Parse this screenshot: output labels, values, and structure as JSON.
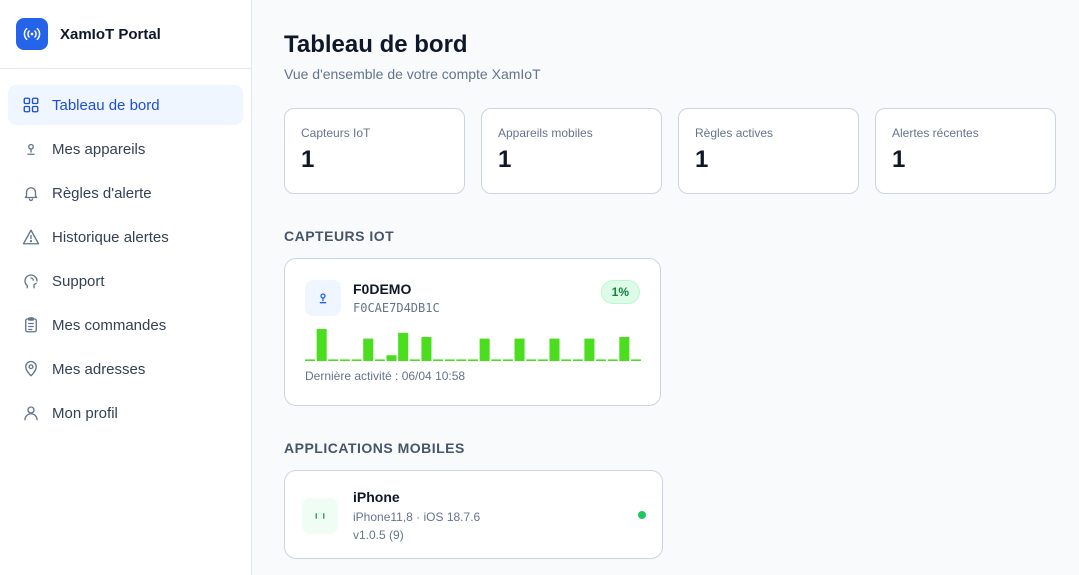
{
  "app": {
    "name": "XamIoT Portal"
  },
  "colors": {
    "accent": "#2563eb",
    "active_bg": "#eff6ff",
    "bar_green": "#4ade1f",
    "online": "#22c55e"
  },
  "sidebar": {
    "items": [
      {
        "label": "Tableau de bord",
        "icon": "grid-icon",
        "active": true
      },
      {
        "label": "Mes appareils",
        "icon": "sensor-icon",
        "active": false
      },
      {
        "label": "Règles d'alerte",
        "icon": "bell-icon",
        "active": false
      },
      {
        "label": "Historique alertes",
        "icon": "warning-icon",
        "active": false
      },
      {
        "label": "Support",
        "icon": "support-icon",
        "active": false
      },
      {
        "label": "Mes commandes",
        "icon": "clipboard-icon",
        "active": false
      },
      {
        "label": "Mes adresses",
        "icon": "map-pin-icon",
        "active": false
      },
      {
        "label": "Mon profil",
        "icon": "user-icon",
        "active": false
      }
    ]
  },
  "header": {
    "title": "Tableau de bord",
    "subtitle": "Vue d'ensemble de votre compte XamIoT"
  },
  "stats": [
    {
      "label": "Capteurs IoT",
      "value": "1"
    },
    {
      "label": "Appareils mobiles",
      "value": "1"
    },
    {
      "label": "Règles actives",
      "value": "1"
    },
    {
      "label": "Alertes récentes",
      "value": "1"
    }
  ],
  "sensors_section": {
    "title": "CAPTEURS IOT",
    "sensor": {
      "name": "F0DEMO",
      "id": "F0CAE7D4DB1C",
      "badge": "1%",
      "last_activity": "Dernière activité : 06/04 10:58",
      "activity_levels": [
        0.05,
        1.0,
        0.05,
        0.05,
        0.05,
        0.7,
        0.05,
        0.18,
        0.88,
        0.05,
        0.75,
        0.05,
        0.05,
        0.05,
        0.05,
        0.7,
        0.05,
        0.05,
        0.7,
        0.05,
        0.05,
        0.7,
        0.05,
        0.05,
        0.7,
        0.05,
        0.05,
        0.75,
        0.05
      ]
    }
  },
  "mobile_section": {
    "title": "APPLICATIONS MOBILES",
    "device": {
      "name": "iPhone",
      "model": "iPhone11,8 · iOS 18.7.6",
      "version": "v1.0.5 (9)",
      "online": true
    }
  }
}
